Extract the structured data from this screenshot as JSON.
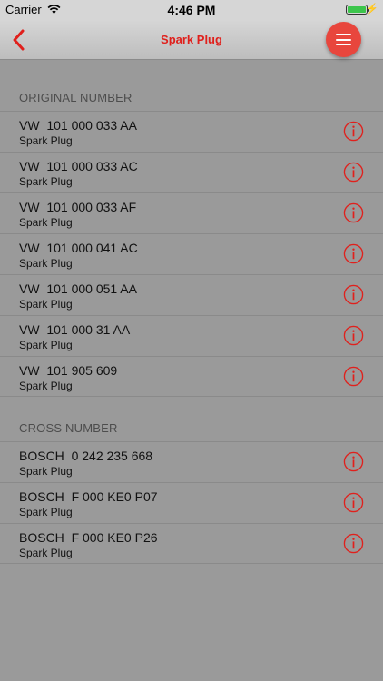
{
  "status_bar": {
    "carrier": "Carrier",
    "time": "4:46 PM"
  },
  "navbar": {
    "title": "Spark Plug",
    "back_icon": "chevron-left-icon",
    "menu_icon": "hamburger-menu-icon"
  },
  "colors": {
    "accent": "#e0201c",
    "menu_button": "#e8463d",
    "background": "#9a9a9a"
  },
  "sections": {
    "original": {
      "header": "ORIGINAL NUMBER",
      "items": [
        {
          "title": "VW  101 000 033 AA",
          "subtitle": "Spark Plug"
        },
        {
          "title": "VW  101 000 033 AC",
          "subtitle": "Spark Plug"
        },
        {
          "title": "VW  101 000 033 AF",
          "subtitle": "Spark Plug"
        },
        {
          "title": "VW  101 000 041 AC",
          "subtitle": "Spark Plug"
        },
        {
          "title": "VW  101 000 051 AA",
          "subtitle": "Spark Plug"
        },
        {
          "title": "VW  101 000 31 AA",
          "subtitle": "Spark Plug"
        },
        {
          "title": "VW  101 905 609",
          "subtitle": "Spark Plug"
        }
      ]
    },
    "cross": {
      "header": "CROSS NUMBER",
      "items": [
        {
          "title": "BOSCH  0 242 235 668",
          "subtitle": "Spark Plug"
        },
        {
          "title": "BOSCH  F 000 KE0 P07",
          "subtitle": "Spark Plug"
        },
        {
          "title": "BOSCH  F 000 KE0 P26",
          "subtitle": "Spark Plug"
        }
      ]
    }
  }
}
